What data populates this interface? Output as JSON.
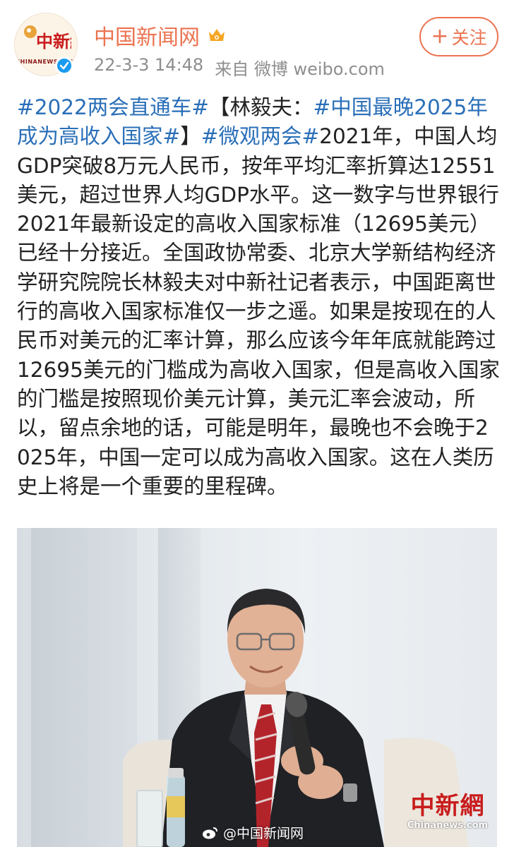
{
  "header": {
    "avatar_logo_text": "中新網",
    "avatar_sub_text": "CHINANEWS.COM",
    "account_name": "中国新闻网",
    "timestamp": "22-3-3 14:48",
    "source_prefix": "来自",
    "source_app": "微博 weibo.com",
    "follow_plus": "+",
    "follow_label": "关注"
  },
  "post": {
    "hashtag_1": "#2022两会直通车#",
    "text_1": "【林毅夫：",
    "hashtag_2": "#中国最晚2025年成为高收入国家#",
    "text_2": "】",
    "hashtag_3": "#微观两会#",
    "body": "2021年，中国人均GDP突破8万元人民币，按年平均汇率折算达12551美元，超过世界人均GDP水平。这一数字与世界银行2021年最新设定的高收入国家标准（12695美元）已经十分接近。全国政协常委、北京大学新结构经济学研究院院长林毅夫对中新社记者表示，中国距离世行的高收入国家标准仅一步之遥。如果是按现在的人民币对美元的汇率计算，那么应该今年年底就能跨过12695美元的门槛成为高收入国家，但是高收入国家的门槛是按照现价美元计算，美元汇率会波动，所以，留点余地的话，可能是明年，最晚也不会晚于2025年，中国一定可以成为高收入国家。这在人类历史上将是一个重要的里程碑。"
  },
  "image": {
    "watermark_weibo": "@中国新闻网",
    "watermark_cn": "中新網",
    "watermark_en": "Chinanews.com"
  },
  "colors": {
    "accent": "#eb7350",
    "hashtag": "#2a6fb8",
    "meta": "#8e8e8e",
    "verified": "#1a9bf0"
  }
}
